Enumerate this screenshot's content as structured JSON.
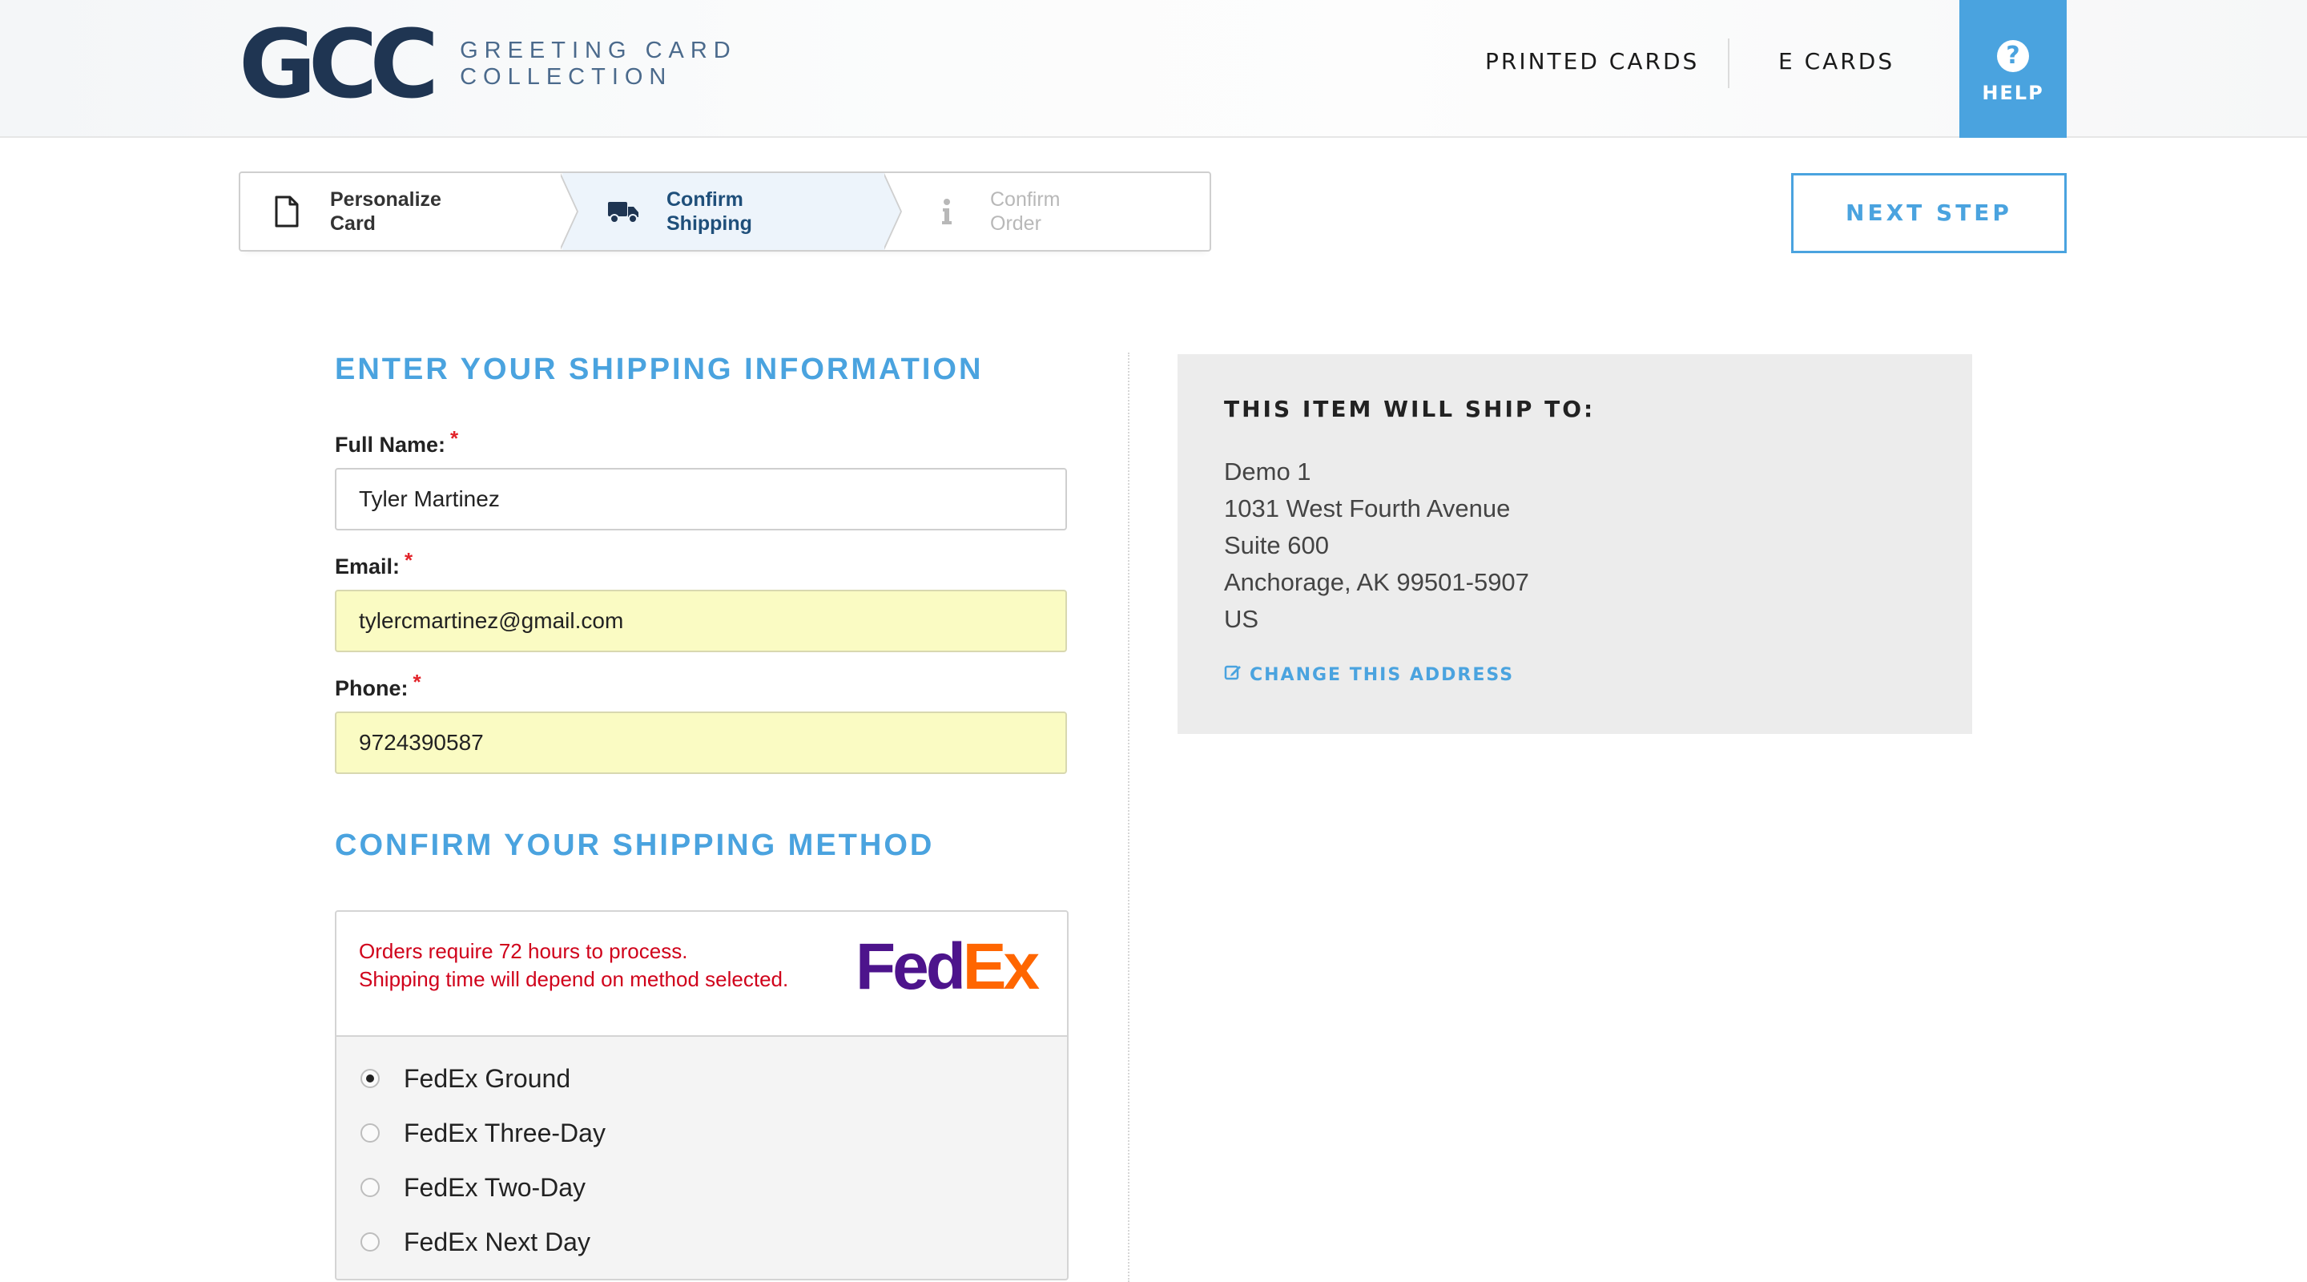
{
  "header": {
    "logo_mark": "GCC",
    "logo_line1": "GREETING CARD",
    "logo_line2": "COLLECTION",
    "nav_printed": "PRINTED CARDS",
    "nav_ecards": "E CARDS",
    "help_icon": "question-circle-icon",
    "help_label": "HELP"
  },
  "steps": [
    {
      "line1": "Personalize",
      "line2": "Card",
      "icon": "document-icon",
      "state": "done"
    },
    {
      "line1": "Confirm",
      "line2": "Shipping",
      "icon": "truck-icon",
      "state": "active"
    },
    {
      "line1": "Confirm",
      "line2": "Order",
      "icon": "info-icon",
      "state": "pending"
    }
  ],
  "next_step_label": "NEXT STEP",
  "shipping_info": {
    "title": "ENTER YOUR SHIPPING INFORMATION",
    "required_mark": "*",
    "full_name_label": "Full Name:",
    "full_name_value": "Tyler Martinez",
    "email_label": "Email:",
    "email_value": "tylercmartinez@gmail.com",
    "phone_label": "Phone:",
    "phone_value": "9724390587"
  },
  "shipping_method": {
    "title": "CONFIRM YOUR SHIPPING METHOD",
    "notice_line1": "Orders require 72 hours to process.",
    "notice_line2": "Shipping time will depend on method selected.",
    "carrier_fed": "Fed",
    "carrier_ex": "Ex",
    "options": [
      {
        "label": "FedEx Ground",
        "selected": true
      },
      {
        "label": "FedEx Three-Day",
        "selected": false
      },
      {
        "label": "FedEx Two-Day",
        "selected": false
      },
      {
        "label": "FedEx Next Day",
        "selected": false
      }
    ]
  },
  "ship_to": {
    "title": "THIS ITEM WILL SHIP TO:",
    "address_lines": [
      "Demo 1",
      "1031 West Fourth Avenue",
      "Suite 600",
      "Anchorage, AK 99501-5907",
      "US"
    ],
    "change_label": "CHANGE THIS ADDRESS",
    "change_icon": "edit-icon"
  },
  "colors": {
    "accent": "#4aa3df",
    "brand_navy": "#1f3552",
    "required": "#e2232a",
    "notice_red": "#d0021b",
    "fedex_purple": "#4d148c",
    "fedex_orange": "#ff6600",
    "autofill_yellow": "#fafbc3"
  }
}
